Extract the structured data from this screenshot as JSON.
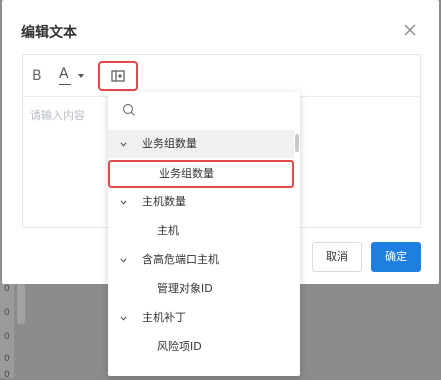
{
  "background": {
    "side_numbers": [
      "0",
      "0",
      "0",
      "0",
      "0"
    ]
  },
  "dialog": {
    "title": "编辑文本",
    "close_icon": "close-icon",
    "toolbar": {
      "bold_label": "B",
      "font_color_label": "A",
      "insert_variable_icon": "insert-variable-icon"
    },
    "editor_placeholder": "请输入内容",
    "cancel_label": "取消",
    "ok_label": "确定",
    "accent_color": "#1f7fe0",
    "highlight_color": "#e5484d"
  },
  "dropdown": {
    "search_icon": "search-icon",
    "items": [
      {
        "label": "业务组数量",
        "type": "group",
        "expanded": true,
        "active": true
      },
      {
        "label": "业务组数量",
        "type": "child",
        "highlighted": true
      },
      {
        "label": "主机数量",
        "type": "group",
        "expanded": true
      },
      {
        "label": "主机",
        "type": "child"
      },
      {
        "label": "含高危端口主机",
        "type": "group",
        "expanded": true
      },
      {
        "label": "管理对象ID",
        "type": "child"
      },
      {
        "label": "主机补丁",
        "type": "group",
        "expanded": true
      },
      {
        "label": "风险项ID",
        "type": "child"
      }
    ]
  }
}
